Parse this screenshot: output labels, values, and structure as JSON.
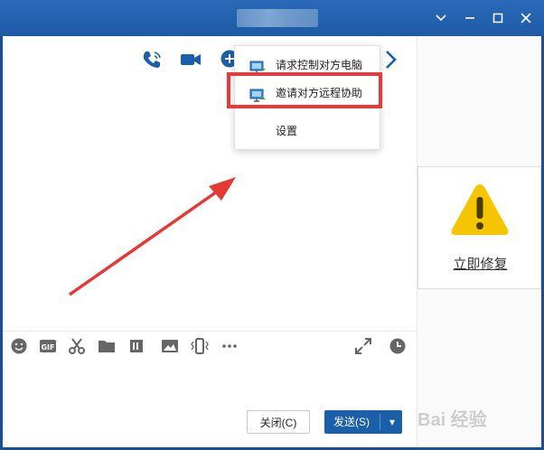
{
  "window": {
    "controls": {
      "minimize": "chevron-down",
      "minimize2": "minus",
      "maximize": "square",
      "close": "x"
    }
  },
  "toolbar": {
    "icons": [
      "phone-icon",
      "video-call-icon",
      "add-member-icon",
      "screen-share-icon",
      "remote-desktop-icon",
      "apps-grid-icon",
      "chevron-right-icon"
    ]
  },
  "menu": {
    "items": [
      {
        "label": "请求控制对方电脑",
        "icon": "monitor-icon"
      },
      {
        "label": "邀请对方远程协助",
        "icon": "monitor-icon"
      },
      {
        "label": "设置",
        "icon": ""
      }
    ]
  },
  "input_toolbar": {
    "icons": [
      "emoji-icon",
      "gif-icon",
      "scissors-icon",
      "folder-icon",
      "scan-icon",
      "image-icon",
      "shake-icon",
      "more-icon",
      "expand-icon",
      "history-icon"
    ]
  },
  "actions": {
    "close_label": "关闭(C)",
    "send_label": "发送(S)",
    "send_dropdown": "▾"
  },
  "side_panel": {
    "fix_label": "立即修复",
    "warning_color": "#f5c500"
  },
  "watermark": {
    "text": "Bai 经验"
  },
  "colors": {
    "accent": "#1e5aa6",
    "icon": "#1b5fab",
    "highlight": "#e83a3a"
  }
}
